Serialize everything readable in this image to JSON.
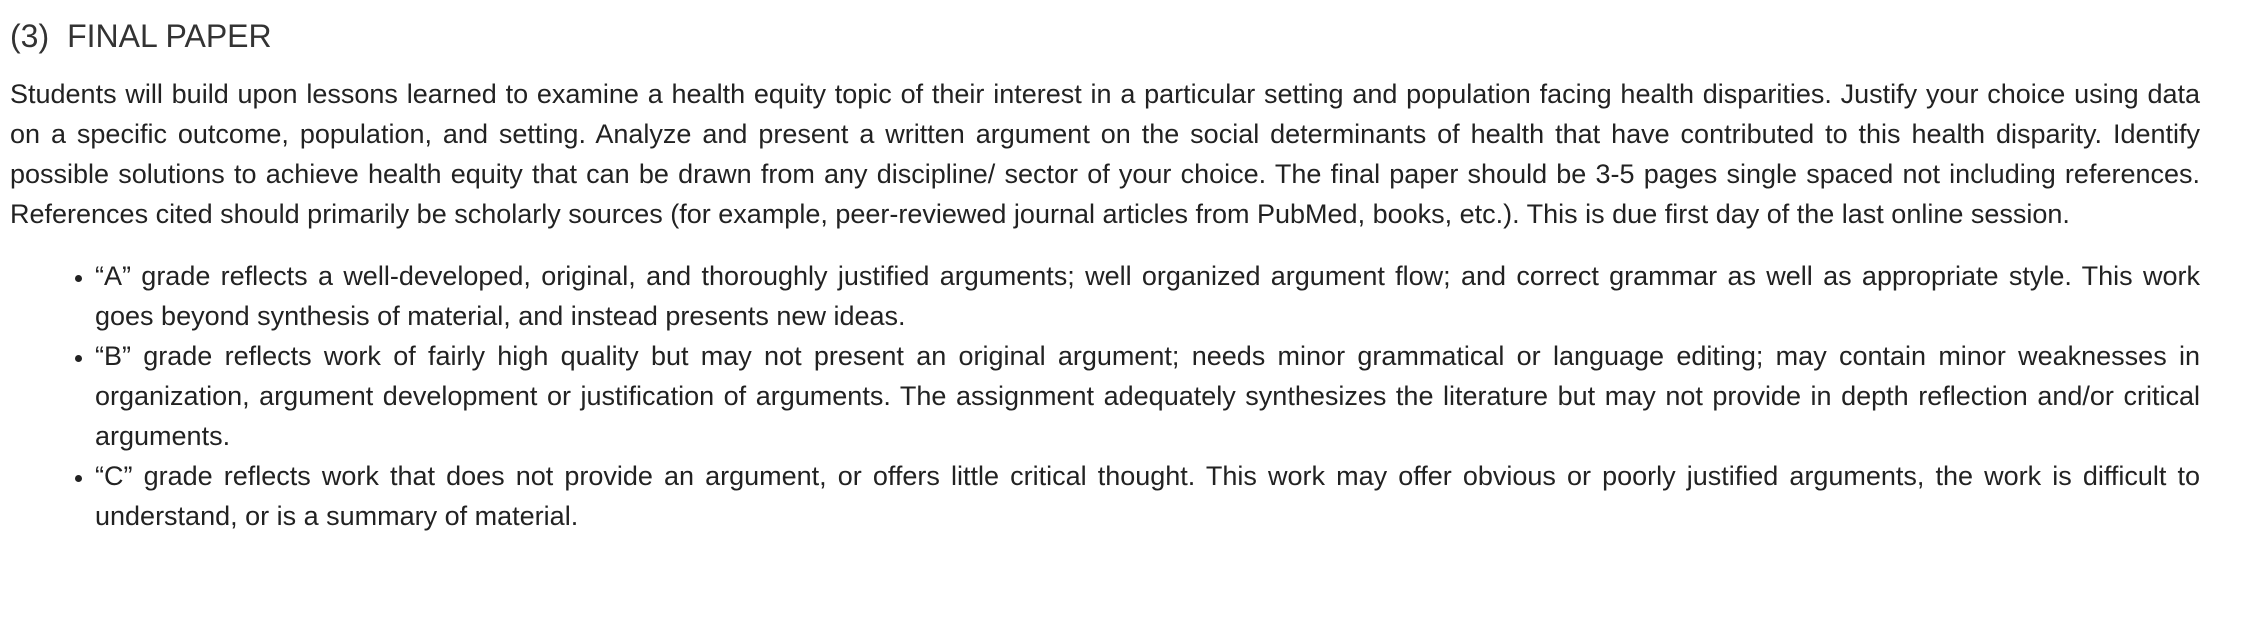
{
  "section": {
    "number": "(3)",
    "title": "FINAL PAPER"
  },
  "intro": "Students will build upon lessons learned to examine a health equity topic of their interest in a particular setting and population facing health disparities. Justify your choice using data on a specific outcome, population, and setting. Analyze and present a written argument on the social determinants of health that have contributed to this health disparity. Identify possible solutions to achieve health equity that can be drawn from any discipline/ sector of your choice. The final paper should be 3-5 pages single spaced not including references. References cited should primarily be scholarly sources (for example, peer-reviewed journal articles from PubMed, books, etc.). This is due first day of the last online session.",
  "grades": [
    "“A” grade reflects a well-developed, original, and thoroughly justified arguments; well organized argument flow; and correct grammar as well as appropriate style. This work goes beyond synthesis of material, and instead presents new ideas.",
    "“B” grade reflects work of fairly high quality but may not present an original argument; needs minor grammatical or language editing; may contain minor weaknesses in organization, argument development or justification of arguments. The assignment adequately synthesizes the literature but may not provide in depth reflection and/or critical arguments.",
    "“C” grade reflects work that does not provide an argument, or offers little critical thought. This work may offer obvious or poorly justified arguments, the work is difficult to understand, or is a summary of material."
  ]
}
